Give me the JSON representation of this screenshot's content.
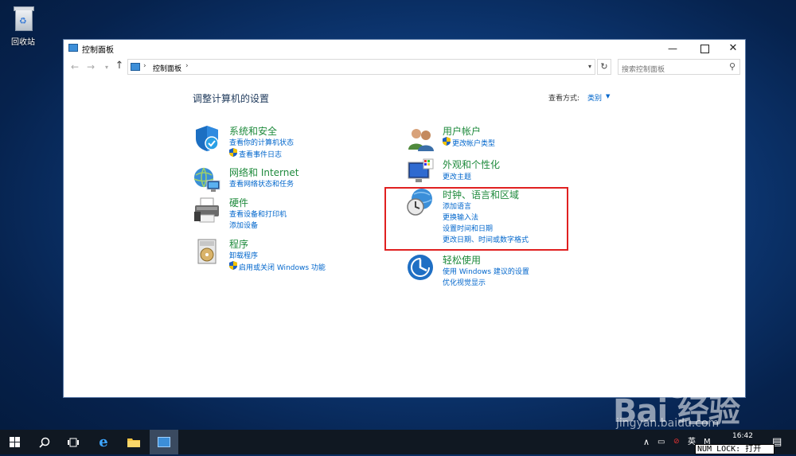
{
  "desktop": {
    "recycle_bin_label": "回收站"
  },
  "window": {
    "title": "控制面板",
    "buttons": {
      "minimize": "—",
      "maximize": "",
      "close": "✕"
    },
    "address": {
      "breadcrumb": "控制面板",
      "separator": "›"
    },
    "search": {
      "placeholder": "搜索控制面板"
    },
    "heading": "调整计算机的设置",
    "view_by": {
      "label": "查看方式:",
      "value": "类别"
    },
    "categories_left": [
      {
        "title": "系统和安全",
        "icon": "shield-icon",
        "links": [
          {
            "text": "查看你的计算机状态",
            "shield": false
          },
          {
            "text": "查看事件日志",
            "shield": true
          }
        ]
      },
      {
        "title": "网络和 Internet",
        "icon": "network-globe-icon",
        "links": [
          {
            "text": "查看网络状态和任务",
            "shield": false
          }
        ]
      },
      {
        "title": "硬件",
        "icon": "printer-icon",
        "links": [
          {
            "text": "查看设备和打印机",
            "shield": false
          },
          {
            "text": "添加设备",
            "shield": false
          }
        ]
      },
      {
        "title": "程序",
        "icon": "programs-disc-icon",
        "links": [
          {
            "text": "卸载程序",
            "shield": false
          },
          {
            "text": "启用或关闭 Windows 功能",
            "shield": true
          }
        ]
      }
    ],
    "categories_right": [
      {
        "title": "用户帐户",
        "icon": "user-accounts-icon",
        "links": [
          {
            "text": "更改帐户类型",
            "shield": true
          }
        ]
      },
      {
        "title": "外观和个性化",
        "icon": "monitor-icon",
        "links": [
          {
            "text": "更改主题",
            "shield": false
          }
        ]
      },
      {
        "title": "时钟、语言和区域",
        "icon": "clock-globe-icon",
        "links": [
          {
            "text": "添加语言",
            "shield": false
          },
          {
            "text": "更换输入法",
            "shield": false
          },
          {
            "text": "设置时间和日期",
            "shield": false
          },
          {
            "text": "更改日期、时间或数字格式",
            "shield": false
          }
        ]
      },
      {
        "title": "轻松使用",
        "icon": "ease-of-access-icon",
        "links": [
          {
            "text": "使用 Windows 建议的设置",
            "shield": false
          },
          {
            "text": "优化视觉显示",
            "shield": false
          }
        ]
      }
    ]
  },
  "taskbar": {
    "ime": "英",
    "ime2": "M",
    "clock_time": "16:42",
    "numlock_text": "NUM LOCK: 打开"
  },
  "watermark": {
    "brand": "Bai  经验",
    "url": "jingyan.baidu.com"
  },
  "colors": {
    "category_title": "#1e8a3c",
    "link": "#0066cc",
    "heading": "#1e395b",
    "highlight_box": "#e02020"
  }
}
